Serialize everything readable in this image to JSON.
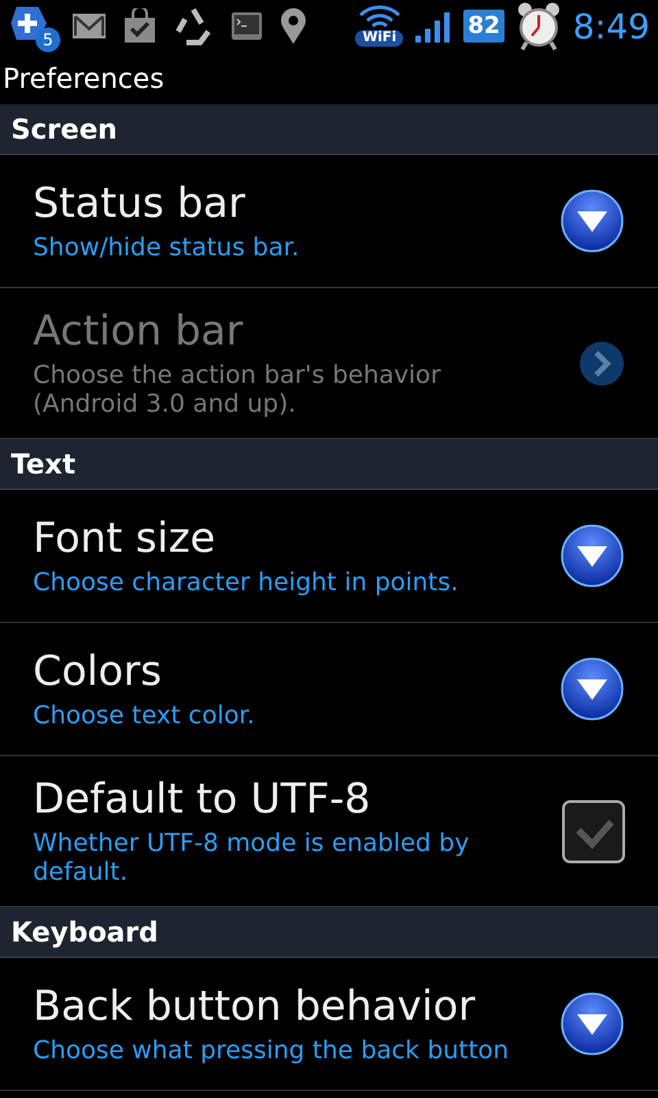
{
  "status_bar": {
    "notification_badge": "5",
    "wifi_label": "WiFi",
    "battery": "82",
    "time": "8:49"
  },
  "title": "Preferences",
  "sections": [
    {
      "header": "Screen",
      "items": [
        {
          "kind": "list",
          "title": "Status bar",
          "summary": "Show/hide status bar.",
          "disabled": false
        },
        {
          "kind": "screen",
          "title": "Action bar",
          "summary": "Choose the action bar's behavior (Android 3.0 and up).",
          "disabled": true
        }
      ]
    },
    {
      "header": "Text",
      "items": [
        {
          "kind": "list",
          "title": "Font size",
          "summary": "Choose character height in points.",
          "disabled": false
        },
        {
          "kind": "list",
          "title": "Colors",
          "summary": "Choose text color.",
          "disabled": false
        },
        {
          "kind": "checkbox",
          "title": "Default to UTF-8",
          "summary": "Whether UTF-8 mode is enabled by default.",
          "disabled": false,
          "checked": false
        }
      ]
    },
    {
      "header": "Keyboard",
      "items": [
        {
          "kind": "list",
          "title": "Back button behavior",
          "summary": "Choose what pressing the back button",
          "disabled": false
        }
      ]
    }
  ]
}
